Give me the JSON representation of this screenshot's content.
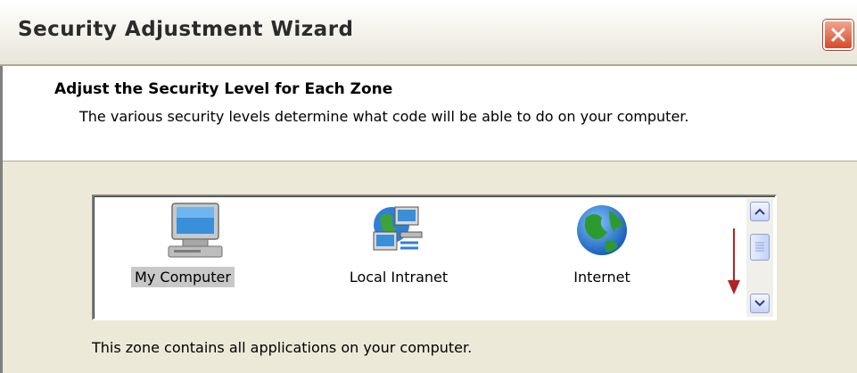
{
  "window": {
    "title": "Security Adjustment Wizard"
  },
  "header": {
    "heading": "Adjust the Security Level for Each Zone",
    "description": "The various security levels determine what code will be able to do on your computer."
  },
  "zones": [
    {
      "label": "My Computer",
      "icon": "my-computer-icon",
      "selected": true
    },
    {
      "label": "Local Intranet",
      "icon": "local-intranet-icon",
      "selected": false
    },
    {
      "label": "Internet",
      "icon": "internet-globe-icon",
      "selected": false
    }
  ],
  "footer": {
    "zone_description": "This zone contains all applications on your computer."
  },
  "colors": {
    "dialog_background": "#ece9d8",
    "selection_highlight": "#c8c8c8",
    "annotation_arrow": "#b22222",
    "close_button": "#d5492b"
  }
}
